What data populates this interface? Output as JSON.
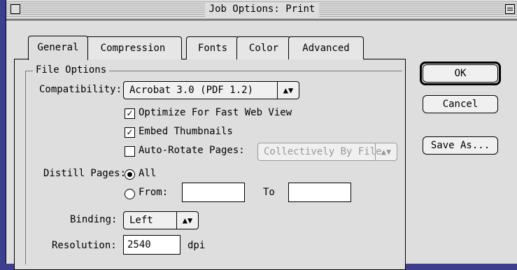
{
  "window": {
    "title": "Job Options: Print"
  },
  "tabs": [
    {
      "label": "General"
    },
    {
      "label": "Compression"
    },
    {
      "label": "Fonts"
    },
    {
      "label": "Color"
    },
    {
      "label": "Advanced"
    }
  ],
  "file_options": {
    "group_label": "File Options",
    "compatibility_label": "Compatibility:",
    "compatibility_value": "Acrobat 3.0 (PDF 1.2)",
    "optimize_label": "Optimize For Fast Web View",
    "optimize_checked": true,
    "embed_label": "Embed Thumbnails",
    "embed_checked": true,
    "autorotate_label": "Auto-Rotate Pages:",
    "autorotate_checked": false,
    "autorotate_value": "Collectively By File",
    "distill_label": "Distill Pages:",
    "distill_all_label": "All",
    "distill_from_label": "From:",
    "distill_to_label": "To",
    "from_value": "",
    "to_value": "",
    "binding_label": "Binding:",
    "binding_value": "Left",
    "resolution_label": "Resolution:",
    "resolution_value": "2540",
    "resolution_unit": "dpi",
    "check_mark": "✓",
    "popup_arrows": "▲▼"
  },
  "buttons": {
    "ok": "OK",
    "cancel": "Cancel",
    "save_as": "Save As..."
  }
}
